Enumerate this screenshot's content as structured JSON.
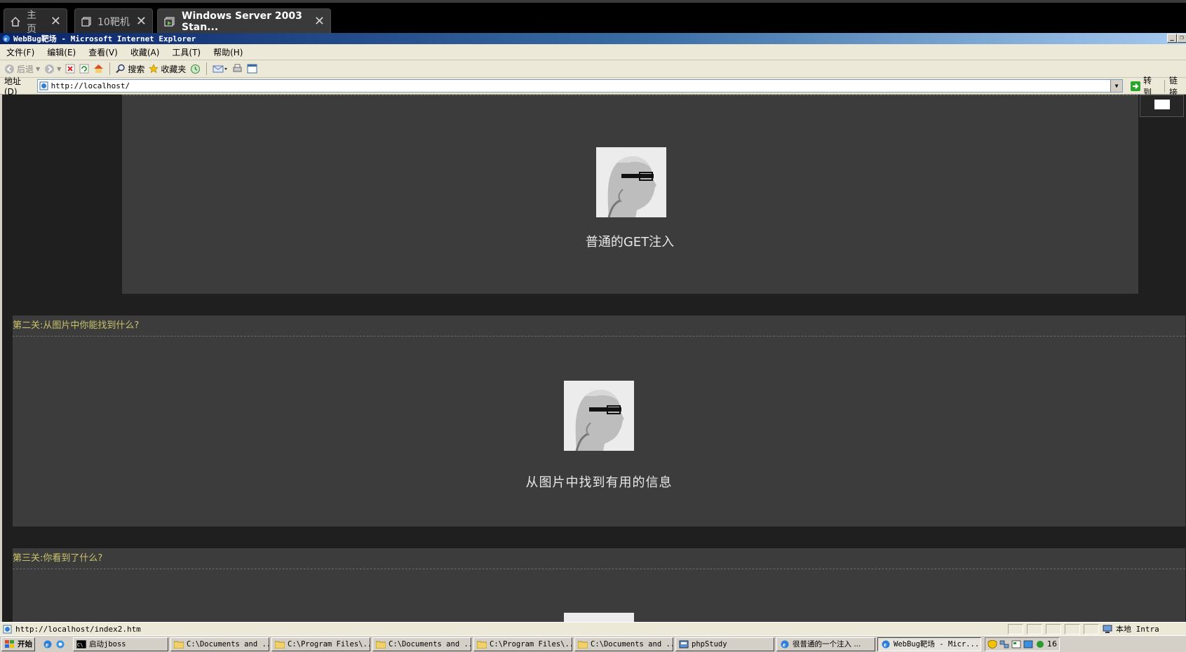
{
  "vm_tabs": [
    {
      "label": "主页",
      "icon": "home-icon"
    },
    {
      "label": "10靶机",
      "icon": "vm-icon"
    },
    {
      "label": "Windows Server 2003 Stan...",
      "icon": "vm-running-icon"
    }
  ],
  "ie": {
    "title": "WebBug靶场 - Microsoft Internet Explorer",
    "menu": [
      "文件(F)",
      "编辑(E)",
      "查看(V)",
      "收藏(A)",
      "工具(T)",
      "帮助(H)"
    ],
    "toolbar": {
      "back": "后退",
      "search": "搜索",
      "favorites": "收藏夹"
    },
    "address_label": "地址(D)",
    "address": "http://localhost/",
    "go": "转到",
    "links": "链接"
  },
  "page": {
    "levels": [
      {
        "caption": "普通的GET注入"
      },
      {
        "heading": "第二关:从图片中你能找到什么?",
        "caption": "从图片中找到有用的信息"
      },
      {
        "heading": "第三关:你看到了什么?"
      }
    ]
  },
  "status": {
    "url": "http://localhost/index2.htm",
    "zone": "本地 Intra"
  },
  "taskbar": {
    "start": "开始",
    "tasks": [
      {
        "label": "启动jboss",
        "icon": "cmd-icon"
      },
      {
        "label": "C:\\Documents and ...",
        "icon": "folder-icon"
      },
      {
        "label": "C:\\Program Files\\...",
        "icon": "folder-icon"
      },
      {
        "label": "C:\\Documents and ...",
        "icon": "folder-icon"
      },
      {
        "label": "C:\\Program Files\\...",
        "icon": "folder-icon"
      },
      {
        "label": "C:\\Documents and ...",
        "icon": "folder-icon"
      },
      {
        "label": "phpStudy",
        "icon": "app-icon"
      },
      {
        "label": "很普通的一个注入 ...",
        "icon": "ie-icon"
      },
      {
        "label": "WebBug靶场 - Micr...",
        "icon": "ie-icon"
      }
    ],
    "clock": "16"
  }
}
